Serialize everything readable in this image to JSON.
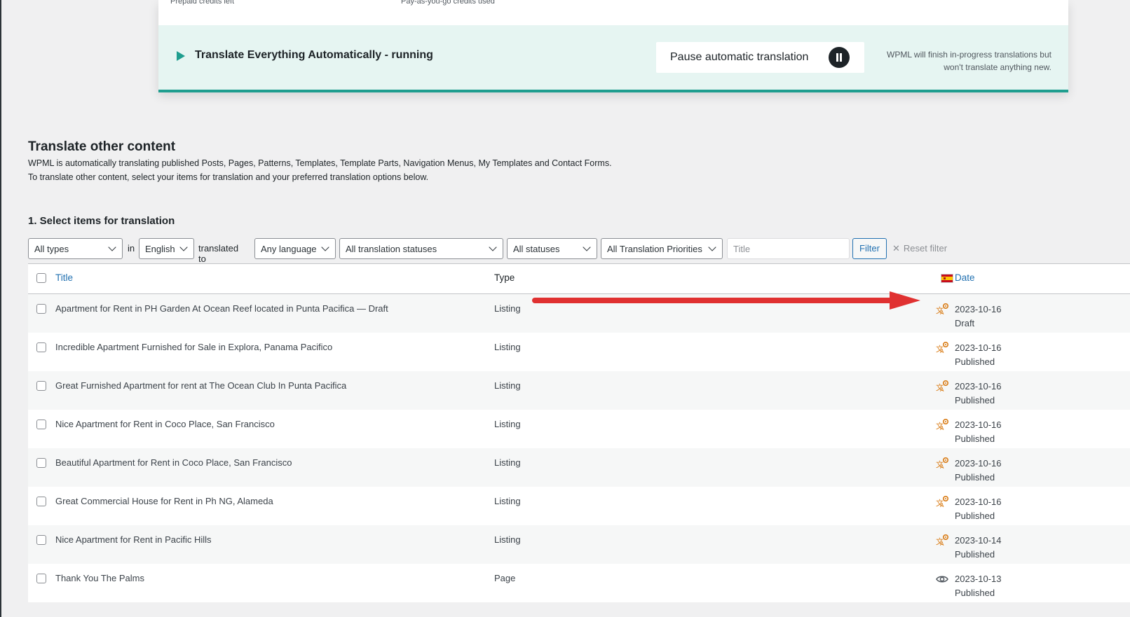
{
  "top_card": {
    "credits_left_label": "Prepaid credits left",
    "credits_used_label": "Pay-as-you-go credits used",
    "running_title": "Translate Everything Automatically - running",
    "pause_button_label": "Pause automatic translation",
    "finish_note": "WPML will finish in-progress translations but won't translate anything new.",
    "accent_color": "#1f9e8f"
  },
  "section": {
    "title": "Translate other content",
    "description_1": "WPML is automatically translating published Posts, Pages, Patterns, Templates, Template Parts, Navigation Menus, My Templates and Contact Forms.",
    "description_2": "To translate other content, select your items for translation and your preferred translation options below.",
    "step_title": "1. Select items for translation"
  },
  "filters": {
    "type": "All types",
    "in_word": "in",
    "language": "English",
    "translated_to_word": "translated to",
    "target_language": "Any language",
    "translation_status": "All translation statuses",
    "status": "All statuses",
    "priority": "All Translation Priorities",
    "title_placeholder": "Title",
    "filter_button": "Filter",
    "reset_filter": "Reset filter"
  },
  "table": {
    "headers": {
      "title": "Title",
      "type": "Type",
      "date": "Date",
      "language_flag": "spain-flag-icon"
    },
    "rows": [
      {
        "title": "Apartment for Rent in PH Garden At Ocean Reef located in Punta Pacifica — Draft",
        "type": "Listing",
        "date": "2023-10-16",
        "status": "Draft",
        "icon": "translate-in-progress-icon"
      },
      {
        "title": "Incredible Apartment Furnished for Sale in Explora, Panama Pacifico",
        "type": "Listing",
        "date": "2023-10-16",
        "status": "Published",
        "icon": "translate-in-progress-icon"
      },
      {
        "title": "Great Furnished Apartment for rent at The Ocean Club In Punta Pacifica",
        "type": "Listing",
        "date": "2023-10-16",
        "status": "Published",
        "icon": "translate-in-progress-icon"
      },
      {
        "title": "Nice Apartment for Rent in Coco Place, San Francisco",
        "type": "Listing",
        "date": "2023-10-16",
        "status": "Published",
        "icon": "translate-in-progress-icon"
      },
      {
        "title": "Beautiful Apartment for Rent in Coco Place, San Francisco",
        "type": "Listing",
        "date": "2023-10-16",
        "status": "Published",
        "icon": "translate-in-progress-icon"
      },
      {
        "title": "Great Commercial House for Rent in Ph NG, Alameda",
        "type": "Listing",
        "date": "2023-10-16",
        "status": "Published",
        "icon": "translate-in-progress-icon"
      },
      {
        "title": "Nice Apartment for Rent in Pacific Hills",
        "type": "Listing",
        "date": "2023-10-14",
        "status": "Published",
        "icon": "translate-in-progress-icon"
      },
      {
        "title": "Thank You The Palms",
        "type": "Page",
        "date": "2023-10-13",
        "status": "Published",
        "icon": "eye-icon"
      }
    ]
  },
  "colors": {
    "link": "#2271b1",
    "translate_icon": "#d97b14",
    "arrow": "#e03131"
  }
}
